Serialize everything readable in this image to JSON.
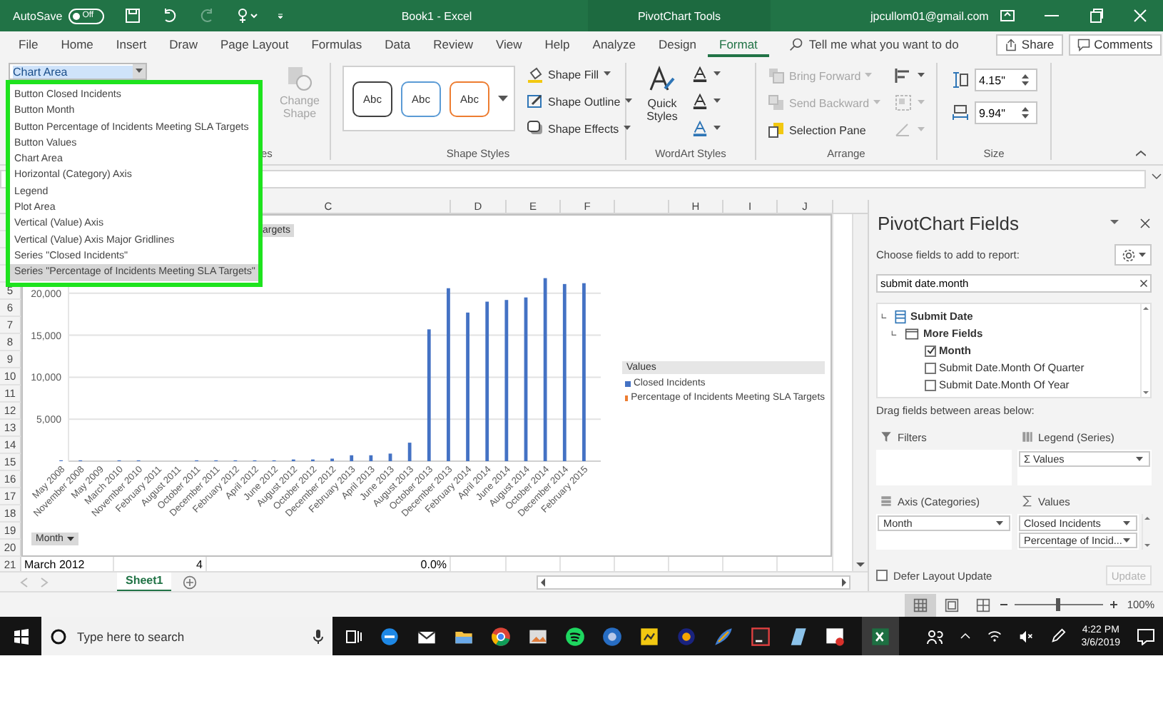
{
  "title_bar": {
    "autosave_label": "AutoSave",
    "autosave_state": "Off",
    "autosave_on": false,
    "document_title": "Book1  -  Excel",
    "context_title": "PivotChart Tools",
    "account": "jpcullom01@gmail.com"
  },
  "ribbon_tabs": [
    {
      "label": "File",
      "selected": false
    },
    {
      "label": "Home",
      "selected": false
    },
    {
      "label": "Insert",
      "selected": false
    },
    {
      "label": "Draw",
      "selected": false
    },
    {
      "label": "Page Layout",
      "selected": false
    },
    {
      "label": "Formulas",
      "selected": false
    },
    {
      "label": "Data",
      "selected": false
    },
    {
      "label": "Review",
      "selected": false
    },
    {
      "label": "View",
      "selected": false
    },
    {
      "label": "Help",
      "selected": false
    },
    {
      "label": "Analyze",
      "selected": false
    },
    {
      "label": "Design",
      "selected": false
    },
    {
      "label": "Format",
      "selected": true
    }
  ],
  "tell_me": {
    "placeholder": "Tell me what you want to do"
  },
  "share_button": "Share",
  "comments_button": "Comments",
  "ribbon": {
    "name_box": {
      "value": "Chart Area"
    },
    "insert_shapes_label": "es",
    "change_shape": {
      "label": "Change Shape",
      "disabled": true
    },
    "shape_styles": {
      "swatches": [
        {
          "label": "Abc",
          "color": "#404040"
        },
        {
          "label": "Abc",
          "color": "#5b9bd5"
        },
        {
          "label": "Abc",
          "color": "#ed7d31"
        }
      ],
      "commands": [
        "Shape Fill",
        "Shape Outline",
        "Shape Effects"
      ],
      "label": "Shape Styles"
    },
    "wordart_styles": {
      "quick_styles": "Quick Styles",
      "label": "WordArt Styles"
    },
    "arrange": {
      "commands": [
        {
          "label": "Bring Forward",
          "disabled": true
        },
        {
          "label": "Send Backward",
          "disabled": true
        },
        {
          "label": "Selection Pane",
          "disabled": false
        }
      ],
      "label": "Arrange"
    },
    "size": {
      "height": "4.15\"",
      "width": "9.94\"",
      "label": "Size"
    }
  },
  "name_box_dropdown": {
    "items": [
      {
        "label": "Button Closed Incidents",
        "selected": false
      },
      {
        "label": "Button Month",
        "selected": false
      },
      {
        "label": "Button Percentage of Incidents Meeting SLA Targets",
        "selected": false
      },
      {
        "label": "Button Values",
        "selected": false
      },
      {
        "label": "Chart Area",
        "selected": false
      },
      {
        "label": "Horizontal (Category) Axis",
        "selected": false
      },
      {
        "label": "Legend",
        "selected": false
      },
      {
        "label": "Plot Area",
        "selected": false
      },
      {
        "label": "Vertical (Value) Axis",
        "selected": false
      },
      {
        "label": "Vertical (Value) Axis Major Gridlines",
        "selected": false
      },
      {
        "label": "Series \"Closed Incidents\"",
        "selected": false
      },
      {
        "label": "Series \"Percentage of Incidents Meeting SLA Targets\"",
        "selected": true
      }
    ]
  },
  "sheet": {
    "columns": [
      "C",
      "D",
      "E",
      "F",
      "H",
      "I",
      "J"
    ],
    "row_numbers": [
      "5",
      "6",
      "7",
      "8",
      "9",
      "10",
      "11",
      "12",
      "13",
      "14",
      "15",
      "16",
      "17",
      "18",
      "19",
      "20",
      "21"
    ],
    "row_21": [
      "March 2012",
      "4",
      "0.0%"
    ]
  },
  "chart": {
    "field_button": "argets",
    "axis_button": "Month",
    "legend_title": "Values",
    "legend_extra": [
      {
        "label": "Percentage of Incidents Meeting SLA Targets",
        "color": "#ed7d31"
      }
    ],
    "chart_data": {
      "type": "bar",
      "categories": [
        "May 2008",
        "November 2008",
        "May 2009",
        "March 2010",
        "November 2010",
        "February 2011",
        "August 2011",
        "October 2011",
        "December 2011",
        "February 2012",
        "April 2012",
        "June 2012",
        "August 2012",
        "October 2012",
        "December 2012",
        "February 2013",
        "April 2013",
        "June 2013",
        "August 2013",
        "October 2013",
        "December 2013",
        "February 2014",
        "April 2014",
        "June 2014",
        "August 2014",
        "October 2014",
        "December 2014",
        "February 2015"
      ],
      "series": [
        {
          "name": "Closed Incidents",
          "color": "#4472c4",
          "values": [
            100,
            100,
            0,
            100,
            100,
            0,
            0,
            100,
            100,
            100,
            100,
            100,
            200,
            200,
            300,
            700,
            700,
            900,
            2200,
            15700,
            20600,
            17700,
            19000,
            19200,
            19500,
            21800,
            21100,
            21200
          ]
        }
      ],
      "ylim": [
        0,
        25000
      ],
      "grid": true,
      "yticks": [
        {
          "value": 5000,
          "label": "5,000"
        },
        {
          "value": 10000,
          "label": "10,000"
        },
        {
          "value": 15000,
          "label": "15,000"
        },
        {
          "value": 20000,
          "label": "20,000"
        }
      ]
    }
  },
  "sheet_tabs": [
    {
      "label": "Sheet1",
      "selected": true
    }
  ],
  "pivot_pane": {
    "title": "PivotChart Fields",
    "choose_label": "Choose fields to add to report:",
    "search": {
      "value": "submit date.month"
    },
    "field_tree": [
      {
        "label": "Submit Date",
        "kind": "table",
        "expanded": true,
        "children": [
          {
            "label": "More Fields",
            "kind": "folder",
            "expanded": true,
            "children": [
              {
                "label": "Month",
                "kind": "field",
                "checked": true
              },
              {
                "label": "Submit Date.Month Of Quarter",
                "kind": "field",
                "checked": false
              },
              {
                "label": "Submit Date.Month Of Year",
                "kind": "field",
                "checked": false
              }
            ]
          }
        ]
      }
    ],
    "drag_label": "Drag fields between areas below:",
    "areas": [
      {
        "kind": "filters",
        "label": "Filters"
      },
      {
        "kind": "legend",
        "label": "Legend (Series)",
        "fields": [
          "Σ Values"
        ]
      },
      {
        "kind": "axis",
        "label": "Axis (Categories)",
        "fields": [
          "Month"
        ]
      },
      {
        "kind": "values",
        "label": "Values",
        "fields": [
          "Closed Incidents",
          "Percentage of Incid..."
        ]
      }
    ],
    "defer_layout_update": {
      "label": "Defer Layout Update",
      "checked": false
    },
    "update_button": {
      "label": "Update",
      "disabled": true
    }
  },
  "status_bar": {
    "views": [
      {
        "kind": "normal",
        "selected": true
      },
      {
        "kind": "page_layout",
        "selected": false
      },
      {
        "kind": "page_break",
        "selected": false
      }
    ],
    "zoom": {
      "level": 0.48,
      "reading": "100%"
    }
  },
  "taskbar": {
    "search_placeholder": "Type here to search",
    "time": "4:22 PM",
    "date": "3/6/2019"
  }
}
